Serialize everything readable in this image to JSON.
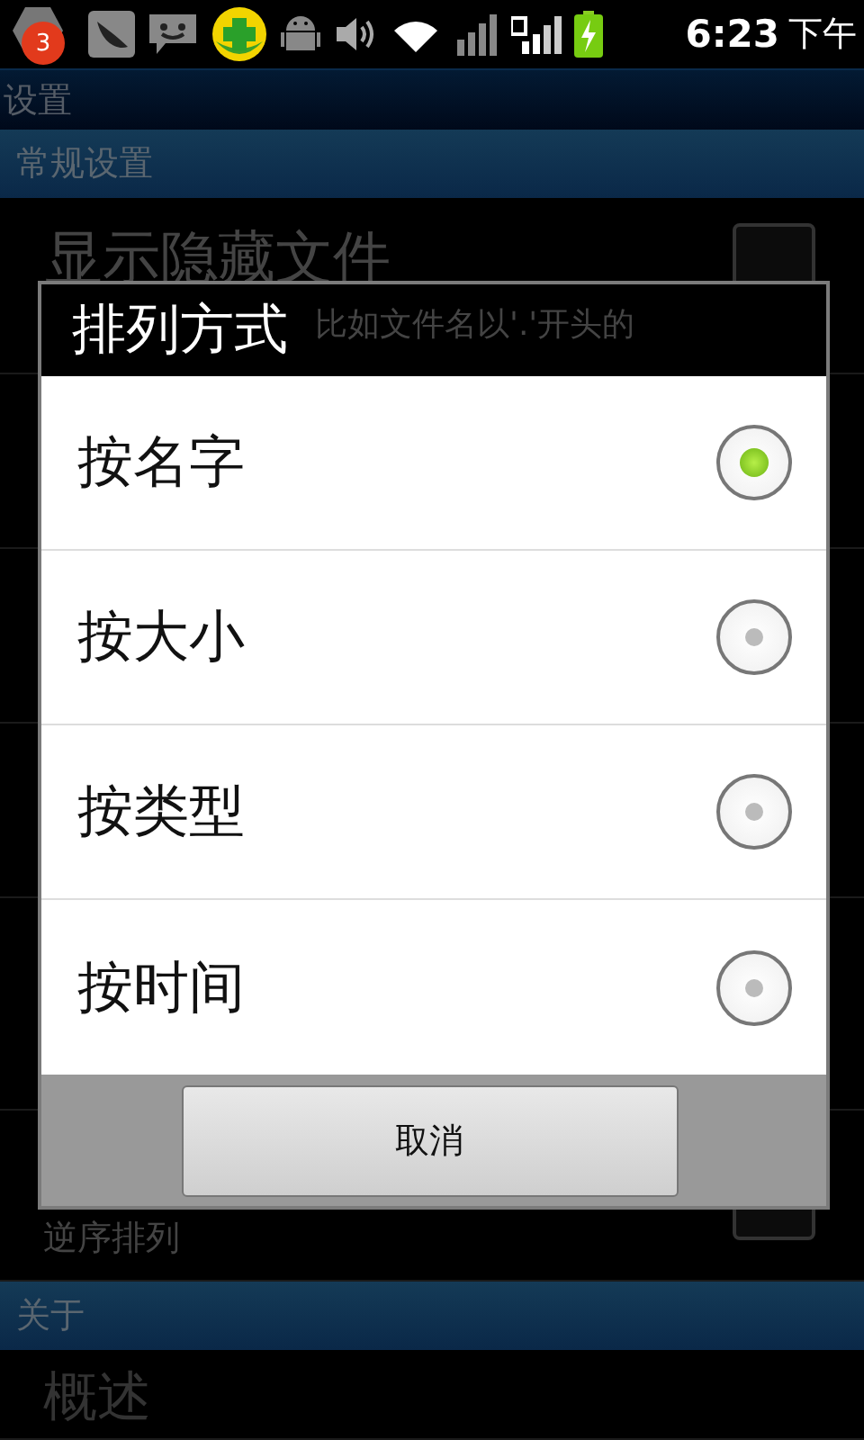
{
  "status_bar": {
    "notification_count": "3",
    "time": "6:23",
    "period": "下午"
  },
  "app_bar": {
    "title": "设置"
  },
  "sections": [
    {
      "header": "常规设置",
      "items": [
        {
          "title": "显示隐藏文件",
          "summary": "比如文件名以'.'开头的",
          "checked": false
        },
        {
          "summary": "逆序排列",
          "checked": false
        }
      ]
    },
    {
      "header": "关于",
      "items": [
        {
          "title": "概述"
        }
      ]
    }
  ],
  "dialog": {
    "title": "排列方式",
    "options": [
      {
        "label": "按名字",
        "selected": true
      },
      {
        "label": "按大小",
        "selected": false
      },
      {
        "label": "按类型",
        "selected": false
      },
      {
        "label": "按时间",
        "selected": false
      }
    ],
    "buttons": [
      "取消"
    ]
  }
}
